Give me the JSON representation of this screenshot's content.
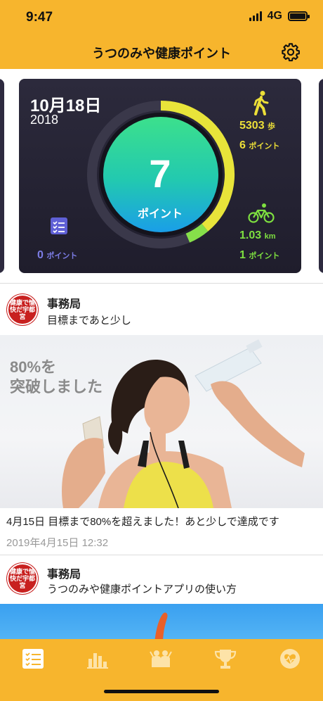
{
  "status_bar": {
    "time": "9:47",
    "network": "4G"
  },
  "header": {
    "title": "うつのみや健康ポイント"
  },
  "stats": {
    "date": "10月18日",
    "year": "2018",
    "total_points": "7",
    "total_points_unit": "ポイント",
    "walking": {
      "steps": "5303",
      "steps_unit": "歩",
      "points": "6",
      "points_unit": "ポイント"
    },
    "cycling": {
      "distance": "1.03",
      "distance_unit": "km",
      "points": "1",
      "points_unit": "ポイント"
    },
    "checklist": {
      "points": "0",
      "points_unit": "ポイント"
    },
    "colors": {
      "walk": "#ecdf38",
      "bike": "#7ee040",
      "list": "#7c7de6"
    }
  },
  "feed": [
    {
      "avatar_text": "健康で愉快だ宇都宮",
      "sender": "事務局",
      "message": "目標まであと少し",
      "image_overlay_line1": "80%を",
      "image_overlay_line2": "突破しました",
      "caption": "4月15日 目標まで80%を超えました！あと少しで達成です",
      "timestamp": "2019年4月15日 12:32"
    },
    {
      "avatar_text": "健康で愉快だ宇都宮",
      "sender": "事務局",
      "message": "うつのみや健康ポイントアプリの使い方"
    }
  ],
  "tabbar": {
    "items": [
      "list-icon",
      "bar-chart-icon",
      "group-icon",
      "trophy-icon",
      "health-icon"
    ]
  }
}
